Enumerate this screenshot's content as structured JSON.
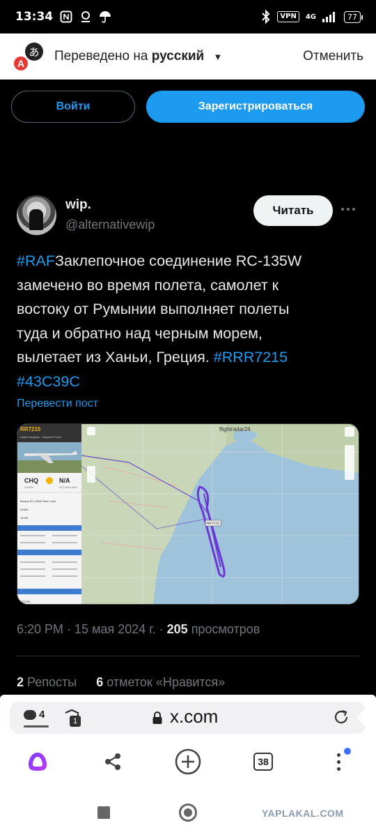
{
  "status_bar": {
    "time": "13:34",
    "vpn_label": "VPN",
    "network": "4G",
    "battery": "77"
  },
  "translate_bar": {
    "prefix": "Переведено на",
    "language": "русский",
    "cancel_label": "Отменить",
    "logo_glyph_left": "A",
    "logo_glyph_right": "あ"
  },
  "auth": {
    "login_label": "Войти",
    "signup_label": "Зарегистрироваться"
  },
  "tweet": {
    "author_name": "wip.",
    "author_handle": "@alternativewip",
    "follow_label": "Читать",
    "text_lines": [
      {
        "hashtag": "#RAF",
        "text": "Заклепочное соединение RC-135W"
      },
      {
        "text": "замечено во время полета, самолет к"
      },
      {
        "text": "востоку от Румынии выполняет полеты"
      },
      {
        "text": "туда и обратно над черным морем,"
      },
      {
        "text": "вылетает из Ханьи, Греция. ",
        "hashtag_after": "#RRR7215"
      },
      {
        "hashtag": "#43C39C"
      }
    ],
    "translate_link": "Перевести пост",
    "time": "6:20 PM",
    "date": "15 мая 2024 г.",
    "views_count": "205",
    "views_label": "просмотров",
    "reposts_count": "2",
    "reposts_label": "Репосты",
    "likes_count": "6",
    "likes_label": "отметок «Нравится»"
  },
  "media": {
    "flight_id": "RR7215",
    "airline": "United Kingdom - Royal Air Force",
    "from_code": "CHQ",
    "from_city": "CHANIA",
    "to_code": "N/A",
    "to_city": "NOT AVAILABLE",
    "aircraft_type": "Boeing RC-135W Rivet Joint",
    "registration": "ZZ665",
    "serial": "18796",
    "hex": "43C39C",
    "map_label": "RR7215",
    "brand": "flightradar24"
  },
  "browser": {
    "comments_count": "4",
    "shield_count": "1",
    "url": "x.com",
    "tabs_count": "38"
  },
  "watermark": "YAPLAKAL.COM"
}
